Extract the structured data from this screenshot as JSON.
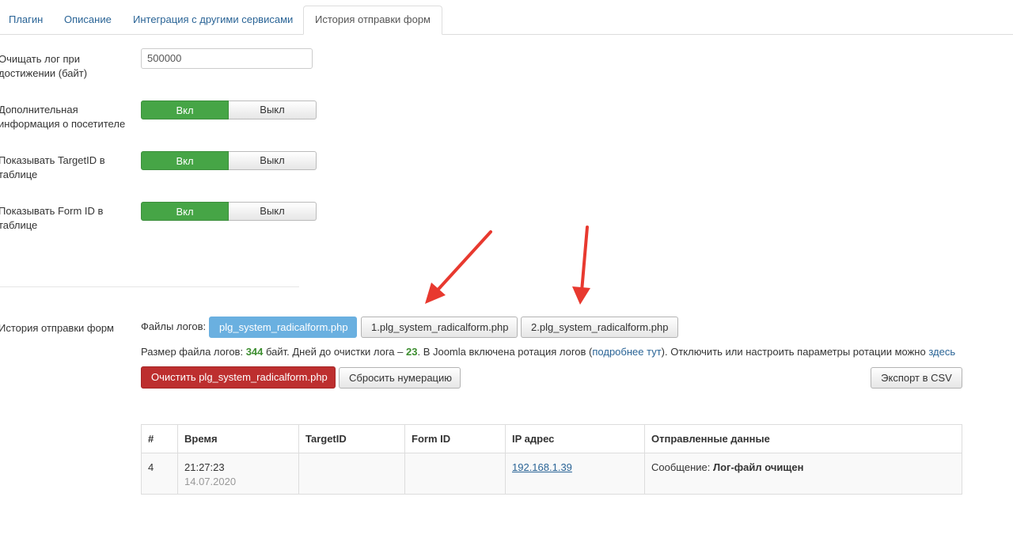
{
  "tabs": [
    {
      "label": "Плагин"
    },
    {
      "label": "Описание"
    },
    {
      "label": "Интеграция с другими сервисами"
    },
    {
      "label": "История отправки форм"
    }
  ],
  "settings": {
    "clear_log": {
      "label": "Очищать лог при достижении (байт)",
      "value": "500000"
    },
    "visitor_info": {
      "label": "Дополнительная информация о посетителе",
      "on": "Вкл",
      "off": "Выкл"
    },
    "show_targetid": {
      "label": "Показывать TargetID в таблице",
      "on": "Вкл",
      "off": "Выкл"
    },
    "show_formid": {
      "label": "Показывать Form ID в таблице",
      "on": "Вкл",
      "off": "Выкл"
    }
  },
  "history": {
    "label": "История отправки форм",
    "files_label": "Файлы логов:",
    "files": [
      "plg_system_radicalform.php",
      "1.plg_system_radicalform.php",
      "2.plg_system_radicalform.php"
    ],
    "info": {
      "p1": "Размер файла логов: ",
      "size": "344",
      "p2": " байт. Дней до очистки лога – ",
      "days": "23",
      "p3": ". В Joomla включена ротация логов (",
      "link1": "подробнее тут",
      "p4": "). Отключить или настроить параметры ротации можно ",
      "link2": "здесь"
    },
    "clear_button": "Очистить plg_system_radicalform.php",
    "reset_button": "Сбросить нумерацию",
    "export_button": "Экспорт в CSV"
  },
  "table": {
    "headers": [
      "#",
      "Время",
      "TargetID",
      "Form ID",
      "IP адрес",
      "Отправленные данные"
    ],
    "rows": [
      {
        "num": "4",
        "time": "21:27:23",
        "date": "14.07.2020",
        "targetid": "",
        "formid": "",
        "ip": "192.168.1.39",
        "data_label": "Сообщение: ",
        "data_value": "Лог-файл очищен"
      }
    ]
  },
  "colors": {
    "accent": "#2a6496",
    "on": "#46a546",
    "danger": "#bd2f2f",
    "file_active": "#6ab0e0",
    "arrow": "#e8392f"
  }
}
